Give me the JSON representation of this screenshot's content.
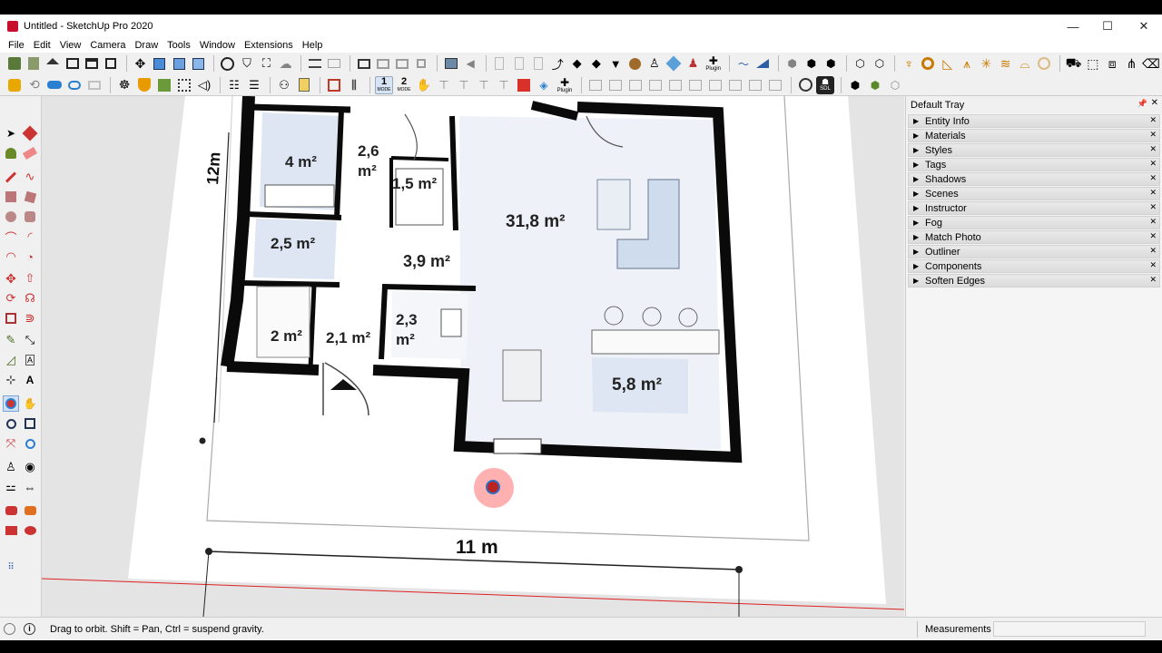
{
  "window": {
    "title": "Untitled - SketchUp Pro 2020"
  },
  "menu": [
    "File",
    "Edit",
    "View",
    "Camera",
    "Draw",
    "Tools",
    "Window",
    "Extensions",
    "Help"
  ],
  "toolbar": {
    "plugin_label": "Plugin",
    "mode1_num": "1",
    "mode2_num": "2",
    "mode_label": "MODE",
    "sdl_label": "SDL"
  },
  "tray": {
    "title": "Default Tray",
    "panels": [
      "Entity Info",
      "Materials",
      "Styles",
      "Tags",
      "Shadows",
      "Scenes",
      "Instructor",
      "Fog",
      "Match Photo",
      "Outliner",
      "Components",
      "Soften Edges"
    ]
  },
  "plan": {
    "dim_vertical": "12m",
    "dim_horizontal": "11 m",
    "rooms": [
      "4 m²",
      "2,6",
      "m²",
      "1,5 m²",
      "31,8 m²",
      "2,5 m²",
      "3,9 m²",
      "2 m²",
      "2,1 m²",
      "2,3",
      "m²",
      "5,8 m²"
    ]
  },
  "status": {
    "hint": "Drag to orbit. Shift = Pan, Ctrl = suspend gravity.",
    "measurements_label": "Measurements",
    "measurements_value": ""
  },
  "colors": {
    "accent_red": "#c8102e",
    "room_fill": "#dde6f2",
    "wall": "#0a0a0a"
  }
}
